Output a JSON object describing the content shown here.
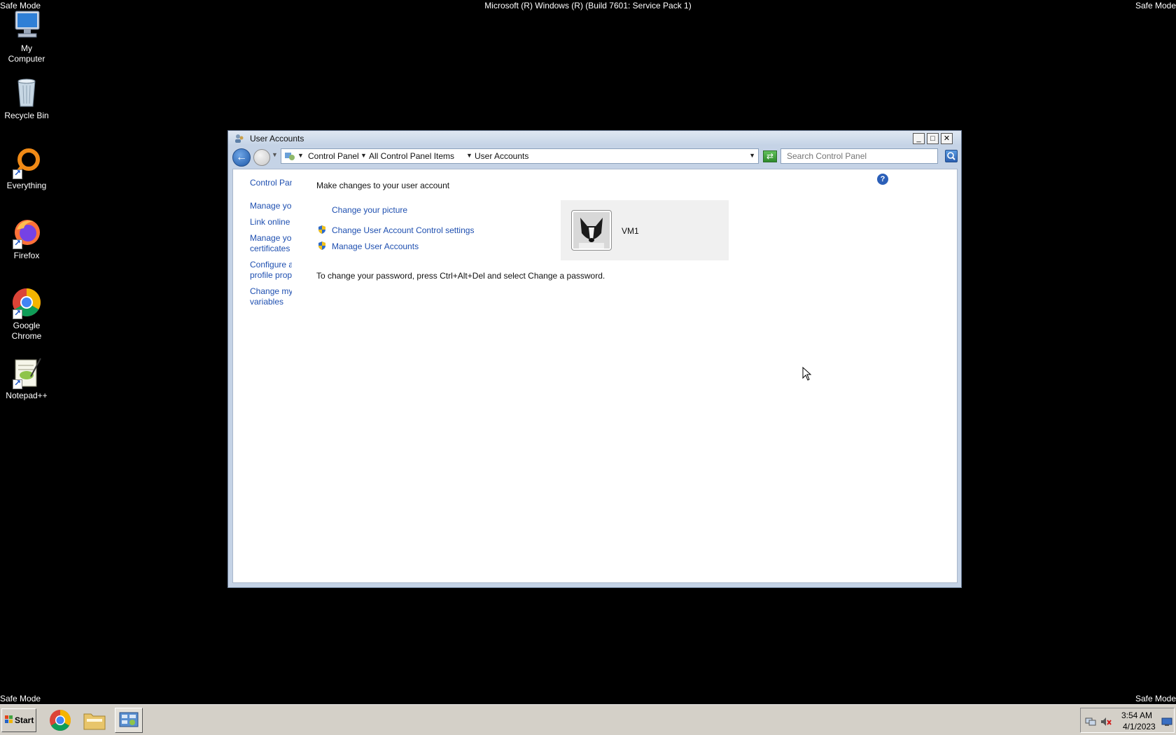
{
  "desktop": {
    "safe_mode_label": "Safe Mode",
    "build_text": "Microsoft (R) Windows (R) (Build 7601: Service Pack 1)",
    "icons": [
      {
        "label_line1": "My",
        "label_line2": "Computer",
        "icon": "computer-icon"
      },
      {
        "label_line1": "Recycle Bin",
        "label_line2": "",
        "icon": "recycle-bin-icon"
      },
      {
        "label_line1": "Everything",
        "label_line2": "",
        "icon": "everything-icon"
      },
      {
        "label_line1": "Firefox",
        "label_line2": "",
        "icon": "firefox-icon"
      },
      {
        "label_line1": "Google",
        "label_line2": "Chrome",
        "icon": "chrome-icon"
      },
      {
        "label_line1": "Notepad++",
        "label_line2": "",
        "icon": "notepadpp-icon"
      }
    ]
  },
  "window": {
    "title": "User Accounts",
    "minimize_glyph": "_",
    "maximize_glyph": "□",
    "close_glyph": "✕",
    "breadcrumbs": [
      "Control Panel",
      "All Control Panel Items",
      "User Accounts"
    ],
    "search_placeholder": "Search Control Panel",
    "help_glyph": "?",
    "sidebar_links": [
      "Control Panel Home",
      "Manage your credentials",
      "Link online IDs",
      "Manage your file encryption",
      "certificates",
      "Configure advanced user",
      "profile properties",
      "Change my environment",
      "variables"
    ],
    "main": {
      "heading": "Make changes to your user account",
      "links": {
        "change_picture": "Change your picture",
        "uac_settings": "Change User Account Control settings",
        "manage_accounts": "Manage User Accounts"
      },
      "password_hint": "To change your password, press Ctrl+Alt+Del and select Change a password.",
      "account_name": "VM1"
    }
  },
  "taskbar": {
    "start_label": "Start",
    "clock_time": "3:54 AM",
    "clock_date": "4/1/2023"
  },
  "colors": {
    "link": "#1e4fb0",
    "desktop_bg": "#000000",
    "taskbar_bg": "#d4d0c8"
  }
}
